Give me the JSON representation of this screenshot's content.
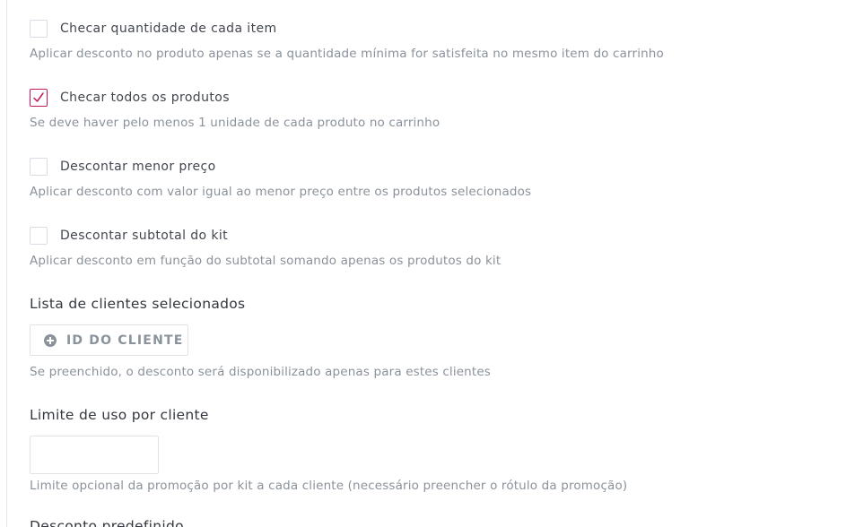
{
  "options": [
    {
      "label": "Checar quantidade de cada item",
      "checked": false,
      "help": "Aplicar desconto no produto apenas se a quantidade mínima for satisfeita no mesmo item do carrinho"
    },
    {
      "label": "Checar todos os produtos",
      "checked": true,
      "help": "Se deve haver pelo menos 1 unidade de cada produto no carrinho"
    },
    {
      "label": "Descontar menor preço",
      "checked": false,
      "help": "Aplicar desconto com valor igual ao menor preço entre os produtos selecionados"
    },
    {
      "label": "Descontar subtotal do kit",
      "checked": false,
      "help": "Aplicar desconto em função do subtotal somando apenas os produtos do kit"
    }
  ],
  "clients": {
    "title": "Lista de clientes selecionados",
    "add_button_label": "ID DO CLIENTE",
    "help": "Se preenchido, o desconto será disponibilizado apenas para estes clientes"
  },
  "usage_limit": {
    "title": "Limite de uso por cliente",
    "value": "",
    "placeholder": "",
    "help": "Limite opcional da promoção por kit a cada cliente (necessário preencher o rótulo da promoção)"
  },
  "next_section": {
    "title": "Desconto predefinido"
  },
  "colors": {
    "accent": "#c2185b",
    "label_text": "#42474f",
    "help_text": "#8a929b",
    "border": "#dfe3e8"
  }
}
